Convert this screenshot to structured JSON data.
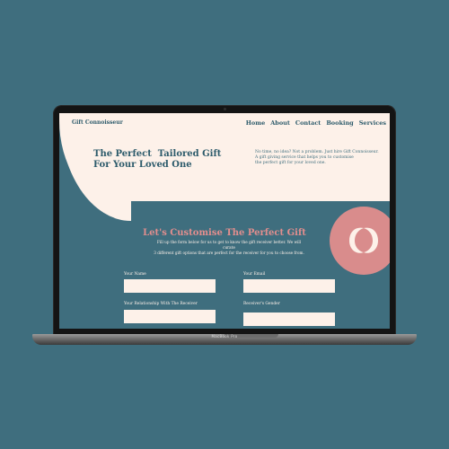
{
  "device": {
    "base_label": "MacBook Pro"
  },
  "site": {
    "logo": "Gift Connoisseur",
    "nav": [
      "Home",
      "About",
      "Contact",
      "Booking",
      "Services"
    ],
    "hero": {
      "title_line1": "The Perfect  Tailored Gift",
      "title_line2": "For Your Loved One",
      "desc_line1": "No time, no idea? Not a problem. Just hire Gift Connoisseur.",
      "desc_line2": "A gift giving service that helps you to customise",
      "desc_line3": "the perfect gift for your loved one."
    },
    "form": {
      "title": "Let's Customise The Perfect Gift",
      "sub_line1": "Fill up the form below for us to get to know the gift receiver better. We will curate",
      "sub_line2": "3 different gift options that are perfect for the receiver for you to choose from.",
      "fields": {
        "name_label": "Your Name",
        "email_label": "Your Email",
        "relationship_label": "Your Relationship With The Receiver",
        "gender_label": "Receiver's Gender"
      }
    },
    "colors": {
      "teal": "#3f6e7e",
      "cream": "#fdf1e9",
      "pink": "#d98c8c",
      "navy": "#2d5b6b"
    }
  }
}
